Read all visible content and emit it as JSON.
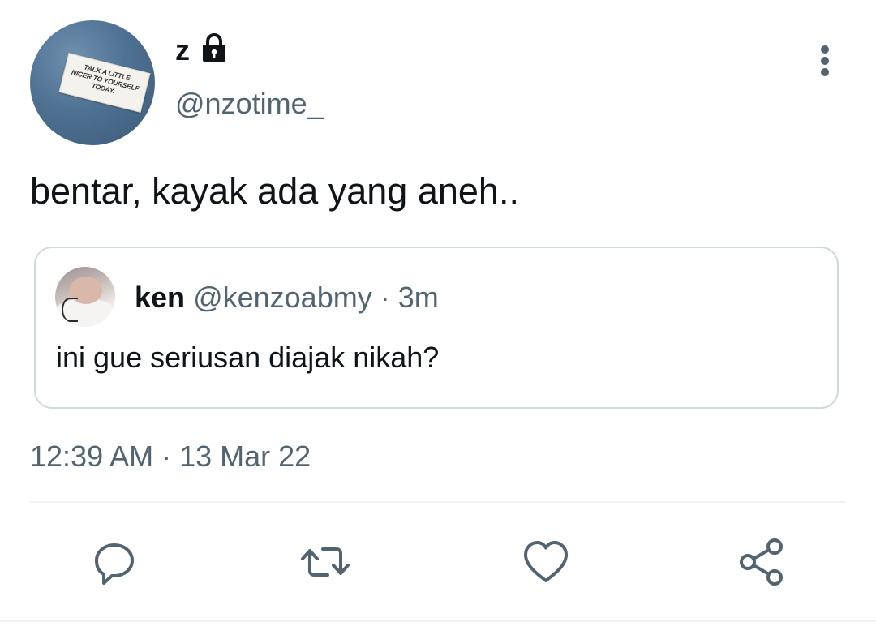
{
  "author": {
    "display_name": "z",
    "handle": "@nzotime_",
    "protected": true,
    "avatar_text": [
      "TALK A LITTLE",
      "NICER TO YOURSELF",
      "TODAY."
    ]
  },
  "tweet": {
    "text": "bentar, kayak ada yang aneh..",
    "timestamp": "12:39 AM · 13 Mar 22"
  },
  "quoted_tweet": {
    "name": "ken",
    "handle": "@kenzoabmy",
    "separator": "·",
    "time": "3m",
    "text": "ini gue seriusan diajak nikah?"
  },
  "actions": {
    "icons": [
      "reply-icon",
      "retweet-icon",
      "like-icon",
      "share-icon"
    ]
  },
  "colors": {
    "text_primary": "#0f1419",
    "text_secondary": "#536471",
    "border": "#cfd9de",
    "icon": "#536471"
  }
}
